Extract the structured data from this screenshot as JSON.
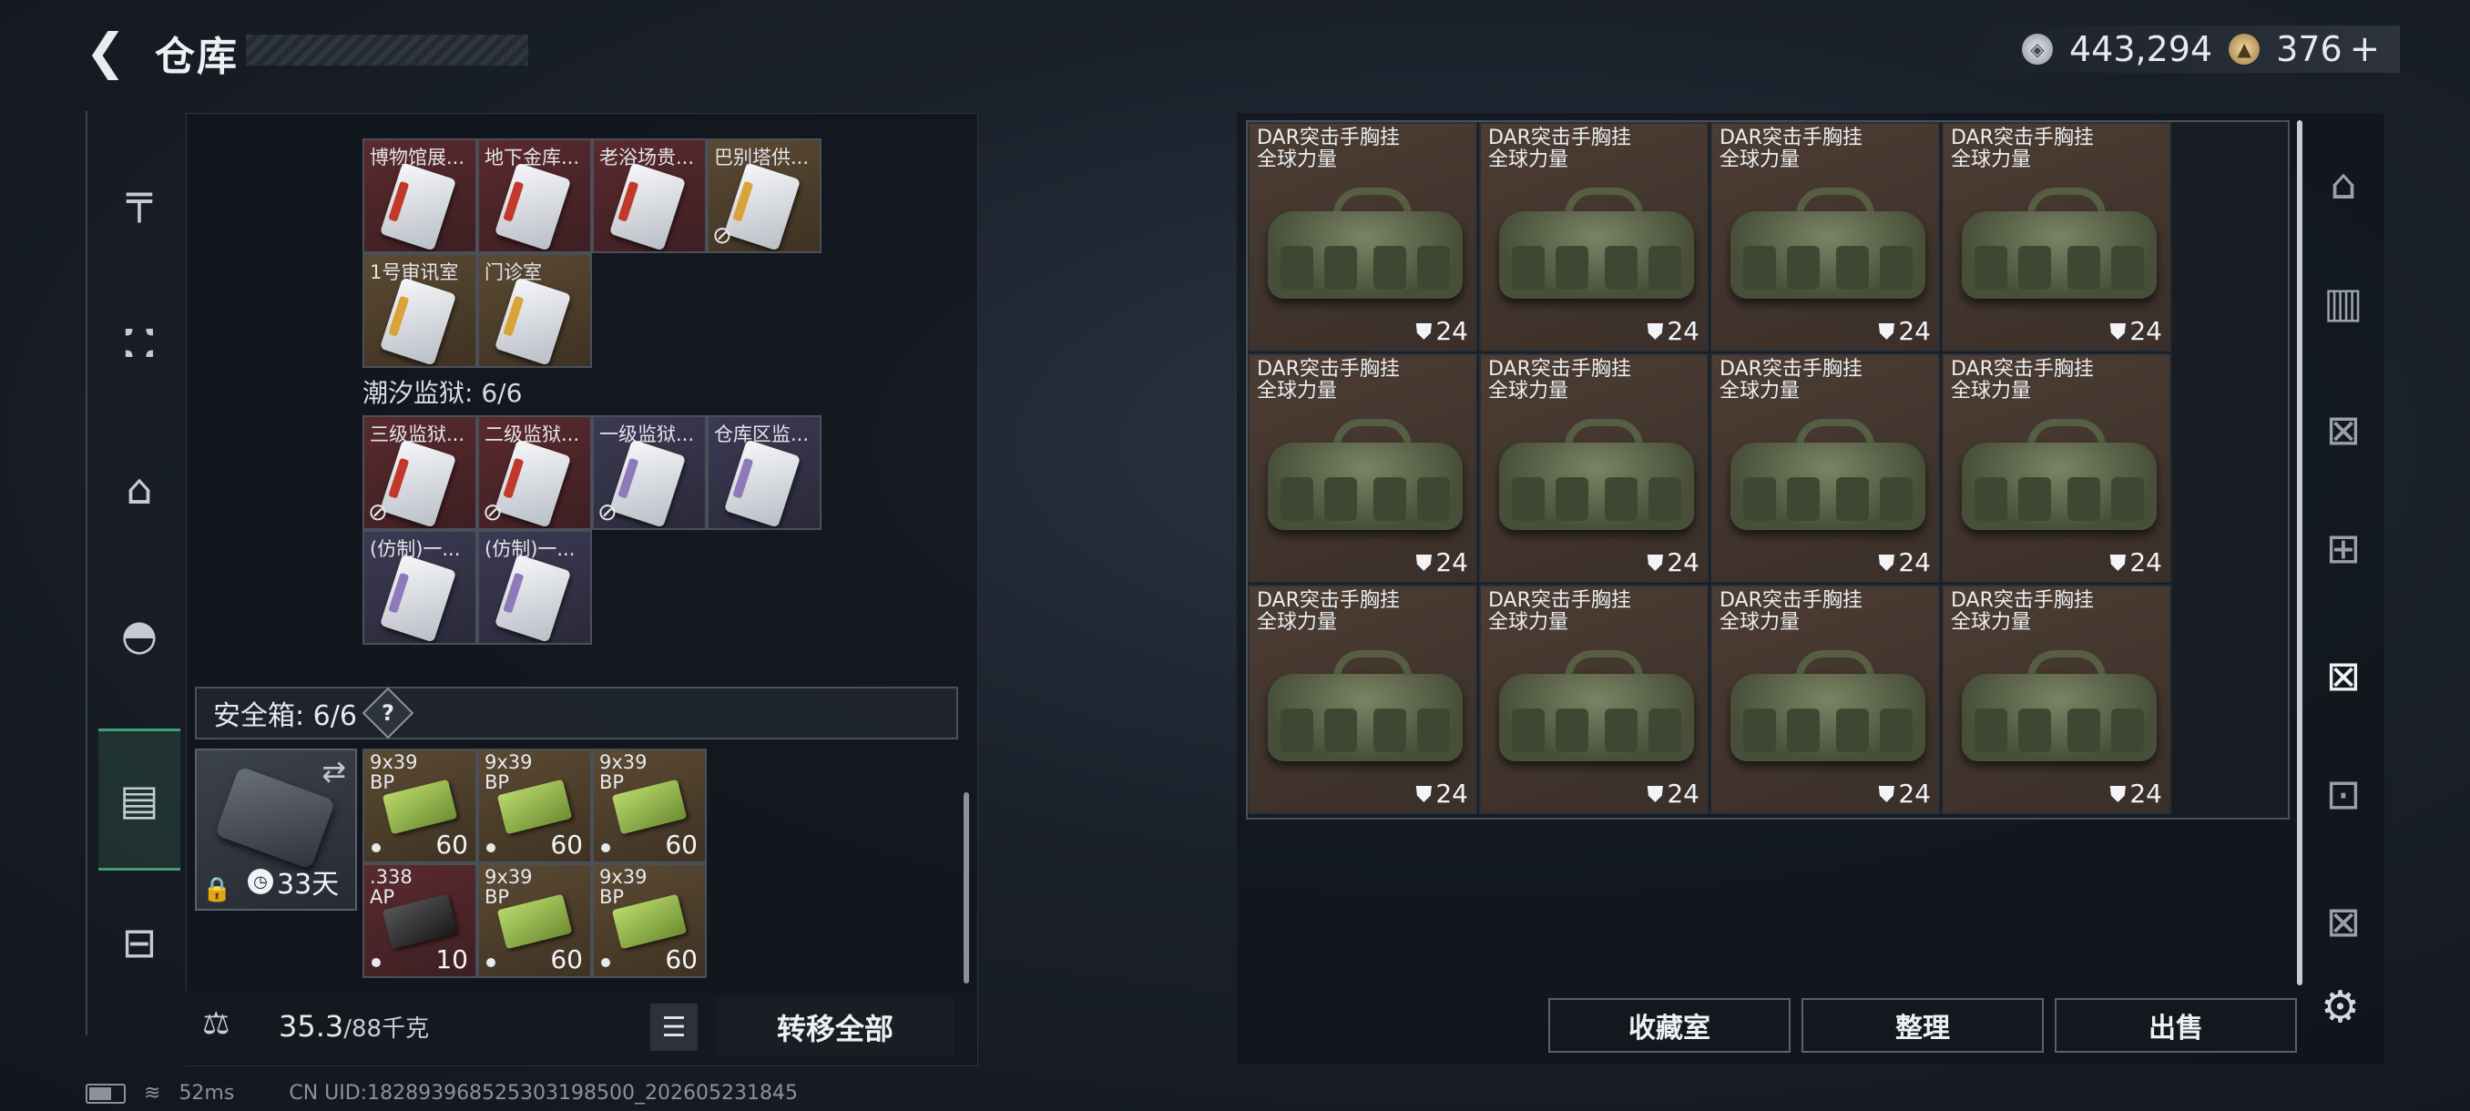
{
  "header": {
    "back_icon": "chevron-left-icon",
    "title": "仓库",
    "currency": {
      "silver_value": "443,294",
      "gold_value": "376",
      "plus": "+"
    }
  },
  "left_nav": {
    "items": [
      {
        "name": "weapon",
        "icon": "pistol-icon",
        "glyph": "╤"
      },
      {
        "name": "vest",
        "icon": "vest-icon",
        "glyph": "⛊"
      },
      {
        "name": "backpack",
        "icon": "backpack-icon",
        "glyph": "⌂"
      },
      {
        "name": "helmet",
        "icon": "helmet-icon",
        "glyph": "◓"
      },
      {
        "name": "safe-case",
        "icon": "case-icon",
        "glyph": "▤",
        "active": true
      },
      {
        "name": "toolbox",
        "icon": "toolbox-icon",
        "glyph": "⊟"
      }
    ]
  },
  "storage": {
    "keycards_group1": [
      {
        "label": "博物馆展...",
        "color": "red"
      },
      {
        "label": "地下金库...",
        "color": "red"
      },
      {
        "label": "老浴场贵...",
        "color": "red"
      },
      {
        "label": "巴别塔供...",
        "color": "gold",
        "restricted": true
      },
      {
        "label": "1号审讯室",
        "color": "gold"
      },
      {
        "label": "门诊室",
        "color": "gold"
      }
    ],
    "section2_title": "潮汐监狱: 6/6",
    "keycards_group2": [
      {
        "label": "三级监狱...",
        "color": "red",
        "restricted": true
      },
      {
        "label": "二级监狱...",
        "color": "red",
        "restricted": true
      },
      {
        "label": "一级监狱...",
        "color": "purple",
        "restricted": true
      },
      {
        "label": "仓库区监...",
        "color": "purple"
      },
      {
        "label": "(仿制)一...",
        "color": "purple"
      },
      {
        "label": "(仿制)一...",
        "color": "purple"
      }
    ],
    "safe_box_label": "安全箱: 6/6",
    "help_glyph": "?",
    "safe_case": {
      "days": "33天"
    },
    "ammo": [
      {
        "label": "9x39\nBP",
        "count": "60",
        "color": "gold"
      },
      {
        "label": "9x39\nBP",
        "count": "60",
        "color": "gold"
      },
      {
        "label": "9x39\nBP",
        "count": "60",
        "color": "gold"
      },
      {
        "label": ".338\nAP",
        "count": "10",
        "color": "red",
        "black": true
      },
      {
        "label": "9x39\nBP",
        "count": "60",
        "color": "gold"
      },
      {
        "label": "9x39\nBP",
        "count": "60",
        "color": "gold"
      }
    ],
    "weight": "35.3",
    "weight_max": "/88千克",
    "transfer_all": "转移全部"
  },
  "stash": {
    "item_name_line1": "DAR突击手胸挂",
    "item_name_line2": "全球力量",
    "item_count": "24",
    "rows": 3,
    "cols": 4
  },
  "right_nav": {
    "items": [
      {
        "icon": "home-arch-icon",
        "glyph": "⌂"
      },
      {
        "icon": "folder-iv-icon",
        "glyph": "▥"
      },
      {
        "icon": "crate-icon",
        "glyph": "⊠"
      },
      {
        "icon": "workbench-icon",
        "glyph": "⊞"
      },
      {
        "icon": "crate-active-icon",
        "glyph": "⊠",
        "active": true
      },
      {
        "icon": "crate-v-icon",
        "glyph": "⊡"
      },
      {
        "icon": "crate-vi-icon",
        "glyph": "⊠"
      }
    ]
  },
  "actions": {
    "collection": "收藏室",
    "sort": "整理",
    "sell": "出售"
  },
  "status": {
    "ping": "52ms",
    "uid": "CN UID:1828939685253031985​00_202605231845"
  },
  "colors": {
    "accent_green": "#3f9d77",
    "item_brown": "#4c3d33",
    "ammo_green": "#b7d86a"
  }
}
